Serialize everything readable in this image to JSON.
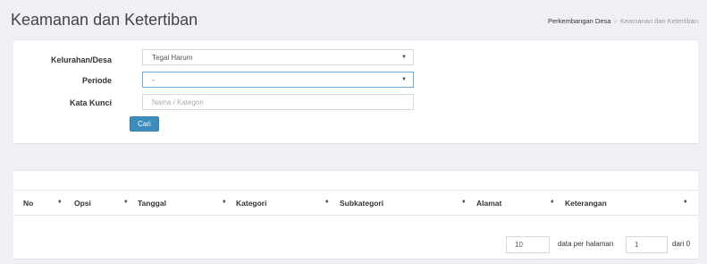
{
  "header": {
    "title": "Keamanan dan Ketertiban",
    "breadcrumb": {
      "parent": "Perkembangan Desa",
      "separator": ">",
      "current": "Keamanan dan Ketertiban"
    }
  },
  "filter": {
    "kelurahan": {
      "label": "Kelurahan/Desa",
      "value": "Tegal Harum"
    },
    "periode": {
      "label": "Periode",
      "value": "-"
    },
    "kata_kunci": {
      "label": "Kata Kunci",
      "placeholder": "Nama / Kategori",
      "value": ""
    },
    "submit_label": "Cari"
  },
  "table": {
    "columns": [
      "No",
      "Opsi",
      "Tanggal",
      "Kategori",
      "Subkategori",
      "Alamat",
      "Keterangan"
    ],
    "rows": []
  },
  "pagination": {
    "per_page": "10",
    "per_page_label": "data per halaman",
    "page": "1",
    "total_label": "dari 0"
  },
  "icons": {
    "sort": "sort-icon",
    "dropdown": "caret-down-icon"
  },
  "colors": {
    "primary": "#3c8dbc",
    "background": "#eef0f3",
    "focus": "#66afe9"
  }
}
